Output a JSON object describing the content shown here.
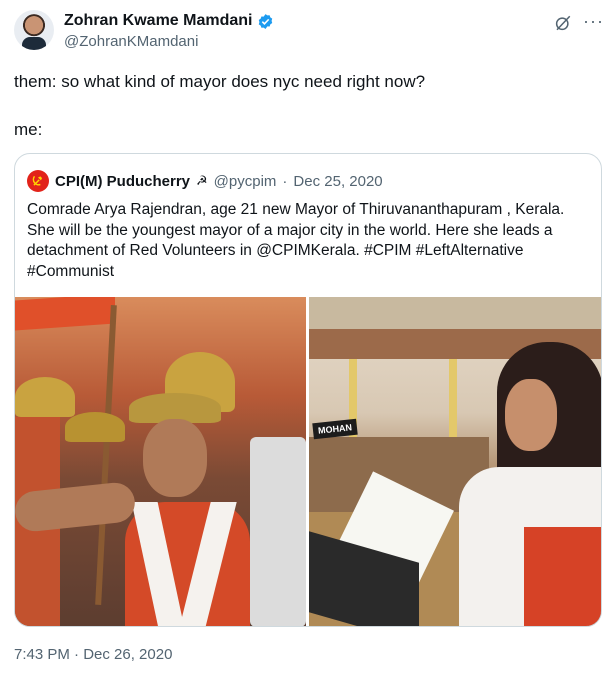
{
  "author": {
    "display_name": "Zohran Kwame Mamdani",
    "handle": "@ZohranKMamdani",
    "verified": true,
    "icons": [
      "verified-badge-icon",
      "grok-icon",
      "more-options-icon"
    ]
  },
  "tweet": {
    "line1": "them: so what kind of mayor does nyc need right now?",
    "line2": "me:",
    "timestamp": "7:43 PM · Dec 26, 2020"
  },
  "quoted_tweet": {
    "display_name": "CPI(M) Puducherry",
    "name_symbol": "☭",
    "handle": "@pycpim",
    "separator": "·",
    "date": "Dec 25, 2020",
    "text_lines": [
      "Comrade Arya Rajendran, age 21  new Mayor of Thiruvananthapuram , Kerala.",
      "She will be the youngest mayor of a major city in the world. Here she leads a",
      "detachment of Red Volunteers in @CPIMKerala. #CPIM  #LeftAlternative",
      "#Communist"
    ],
    "image_sign": "MOHAN"
  },
  "colors": {
    "text_primary": "#0f1419",
    "text_secondary": "#536471",
    "border": "#cfd9de",
    "verified_blue": "#1d9bf0",
    "cpi_red": "#e2231a"
  }
}
